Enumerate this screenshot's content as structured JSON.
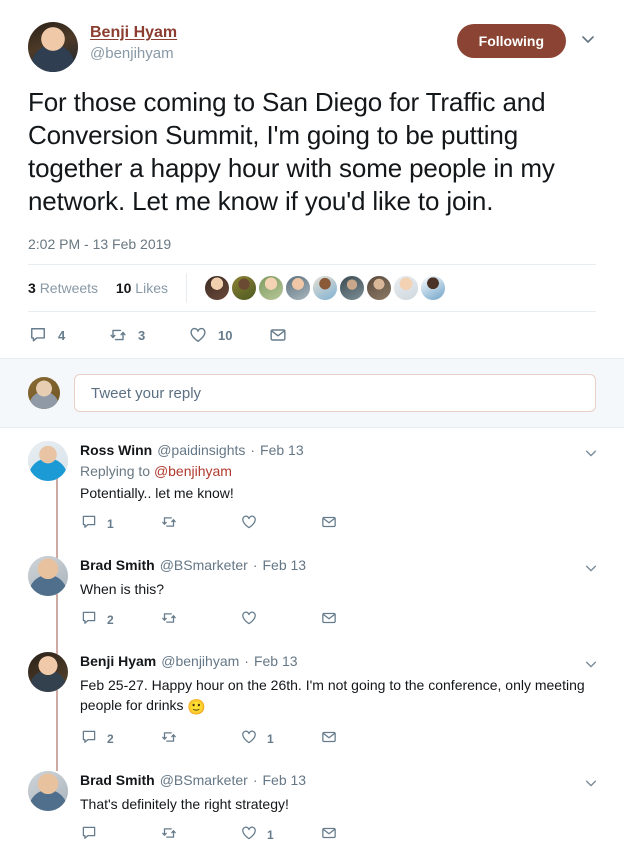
{
  "main_tweet": {
    "display_name": "Benji Hyam",
    "handle": "@benjihyam",
    "follow_button": "Following",
    "text": "For those coming to San Diego for Traffic and Conversion Summit, I'm going to be putting together a happy hour with some people in my network. Let me know if you'd like to join.",
    "timestamp": "2:02 PM - 13 Feb 2019",
    "retweet_count": "3",
    "retweet_label": "Retweets",
    "like_count": "10",
    "like_label": "Likes",
    "actions": {
      "reply_count": "4",
      "retweet_count": "3",
      "like_count": "10",
      "dm": ""
    },
    "facepile_count": 9
  },
  "composer": {
    "placeholder": "Tweet your reply",
    "value": ""
  },
  "replies": [
    {
      "display_name": "Ross Winn",
      "handle": "@paidinsights",
      "separator": "·",
      "date": "Feb 13",
      "replying_to_label": "Replying to",
      "replying_to_mention": "@benjihyam",
      "text": "Potentially.. let me know!",
      "reply_count": "1",
      "retweet_count": "",
      "like_count": "",
      "avatar_palette": [
        "#dfe8ee",
        "#1c9ad6",
        "#c9a887"
      ]
    },
    {
      "display_name": "Brad Smith",
      "handle": "@BSmarketer",
      "separator": "·",
      "date": "Feb 13",
      "replying_to_label": "",
      "replying_to_mention": "",
      "text": "When is this?",
      "reply_count": "2",
      "retweet_count": "",
      "like_count": "",
      "avatar_palette": [
        "#c8cdd2",
        "#e0b89a",
        "#5b7d99"
      ]
    },
    {
      "display_name": "Benji Hyam",
      "handle": "@benjihyam",
      "separator": "·",
      "date": "Feb 13",
      "replying_to_label": "",
      "replying_to_mention": "",
      "text": "Feb 25-27. Happy hour on the 26th. I'm not going to the conference, only meeting people for drinks ",
      "emoji": "🙂",
      "reply_count": "2",
      "retweet_count": "",
      "like_count": "1",
      "avatar_palette": [
        "#2b2118",
        "#e8b894",
        "#3c4a5a"
      ]
    },
    {
      "display_name": "Brad Smith",
      "handle": "@BSmarketer",
      "separator": "·",
      "date": "Feb 13",
      "replying_to_label": "",
      "replying_to_mention": "",
      "text": "That's definitely the right strategy!",
      "reply_count": "",
      "retweet_count": "",
      "like_count": "1",
      "avatar_palette": [
        "#c8cdd2",
        "#e0b89a",
        "#5b7d99"
      ]
    }
  ],
  "colors": {
    "accent": "#8b4433",
    "name_link": "#8b3e2f",
    "mention": "#b03a2e",
    "muted": "#657786",
    "icon": "#667c8c",
    "divider": "#e6ecf0",
    "composer_bg": "#f5f8fa",
    "thread_line": "#cfaaa2"
  },
  "icons": {
    "reply": "reply-icon",
    "retweet": "retweet-icon",
    "like": "heart-icon",
    "dm": "envelope-icon",
    "caret": "chevron-down-icon"
  }
}
